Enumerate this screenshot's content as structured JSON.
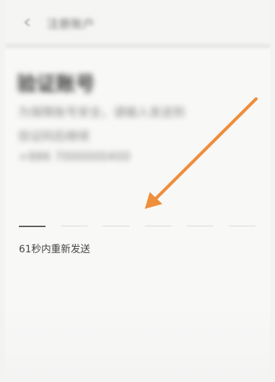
{
  "app_bar": {
    "back_icon": "back-arrow-icon",
    "title": "注册账户"
  },
  "header": {
    "title": "验证账号",
    "description_line1": "为保障账号安全，请输入发送到",
    "description_line2": "验证码后继续",
    "phone": "+886 7000000400"
  },
  "code_input": {
    "length": 6,
    "active_index": 0
  },
  "resend": {
    "text": "61秒内重新发送"
  },
  "annotation": {
    "arrow_color": "#ef8e3b"
  }
}
